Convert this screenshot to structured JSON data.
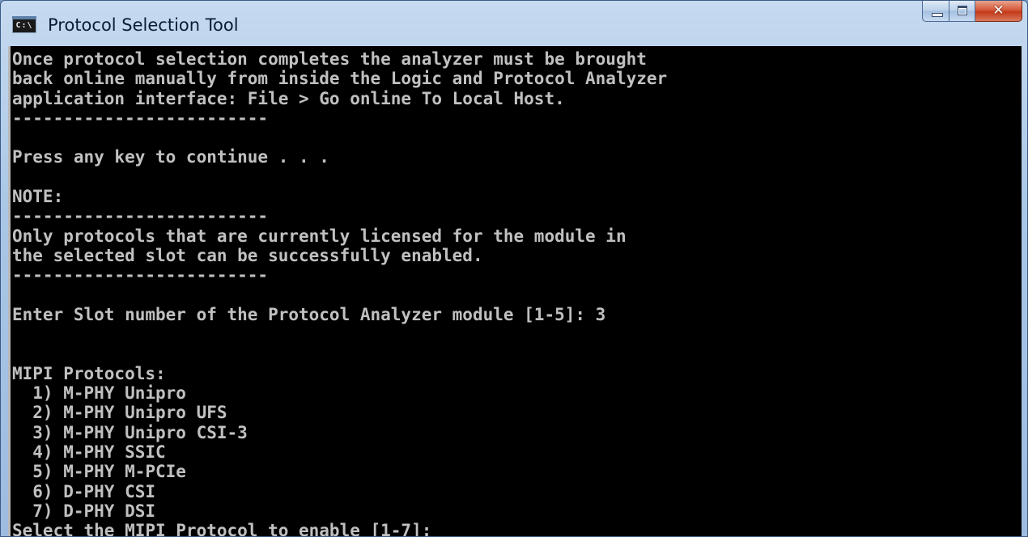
{
  "window": {
    "title": "Protocol Selection Tool",
    "icon": "console-app-icon",
    "icon_text": "C:\\",
    "colors": {
      "console_background": "#000000",
      "console_text": "#c0c0c0",
      "close_button": "#c7452a",
      "title_bar": "#b5cde9"
    }
  },
  "caption_buttons": {
    "minimize": "minimize-icon",
    "maximize": "maximize-icon",
    "close": "close-icon"
  },
  "console": {
    "lines": [
      "Once protocol selection completes the analyzer must be brought",
      "back online manually from inside the Logic and Protocol Analyzer",
      "application interface: File > Go online To Local Host.",
      "-------------------------",
      "",
      "Press any key to continue . . .",
      "",
      "NOTE:",
      "-------------------------",
      "Only protocols that are currently licensed for the module in",
      "the selected slot can be successfully enabled.",
      "-------------------------",
      "",
      "Enter Slot number of the Protocol Analyzer module [1-5]: 3",
      "",
      "",
      "MIPI Protocols:",
      "  1) M-PHY Unipro",
      "  2) M-PHY Unipro UFS",
      "  3) M-PHY Unipro CSI-3",
      "  4) M-PHY SSIC",
      "  5) M-PHY M-PCIe",
      "  6) D-PHY CSI",
      "  7) D-PHY DSI",
      "Select the MIPI Protocol to enable [1-7]: "
    ]
  }
}
